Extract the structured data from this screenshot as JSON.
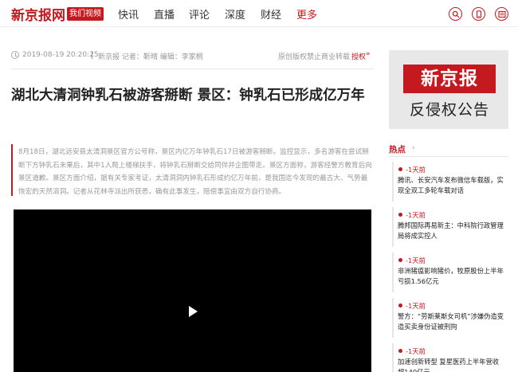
{
  "header": {
    "logo": "新京报网",
    "video_badge": "我们视频",
    "nav": [
      "快讯",
      "直播",
      "评论",
      "深度",
      "财经",
      "更多"
    ],
    "icons": [
      "search-icon",
      "mobile-icon",
      "newspaper-icon"
    ]
  },
  "article": {
    "timestamp": "2019-08-19 20:20:25",
    "byline": "新京报 记者：靳晴 编辑：李家桐",
    "rights_notice": "原创版权禁止商业转载",
    "rights_link": "授权",
    "rights_arrow": "»",
    "title": "湖北大清洞钟乳石被游客掰断 景区：钟乳石已形成亿万年",
    "summary": "8月18日，湖北远安县太清洞景区官方公号称，景区内亿万年钟乳石17日被游客掰断。监控显示，多名游客在尝试掰断下方钟乳石未果后，其中1人爬上楼梯扶手，将钟乳石掰断交给同伴并企图带走。景区方面称，游客经警方教育后向景区道歉。景区方面介绍，据有关专家考证，太清洞洞内钟乳石形成约亿万年前，是我国迄今发现的最古大、气势最恢宏的天然溶洞。记者从花林寺派出所获悉，确有此事发生，赔偿事宜由双方自行协商。"
  },
  "sidebar": {
    "ad_logo": "新京报",
    "ad_text": "反侵权公告",
    "hot_title": "热点",
    "hot_arrow": "›",
    "hot_items": [
      {
        "time": "-1天前",
        "text": "腾讯、长安汽车发布微信车载版，实现全双工多轮车载对话"
      },
      {
        "time": "-1天前",
        "text": "腾邦国际再易新主：中科院行政管理局将成实控人"
      },
      {
        "time": "-1天前",
        "text": "非洲猪瘟影响猪价，牧原股份上半年亏损1.56亿元"
      },
      {
        "time": "-1天前",
        "text": "警方：“劳斯莱斯女司机”涉嫌伪造变造买卖身份证被刑拘"
      },
      {
        "time": "-1天前",
        "text": "加速创新转型 复星医药上半年营收超140亿元"
      }
    ]
  },
  "colors": {
    "accent": "#c4191f",
    "muted": "#999999"
  }
}
